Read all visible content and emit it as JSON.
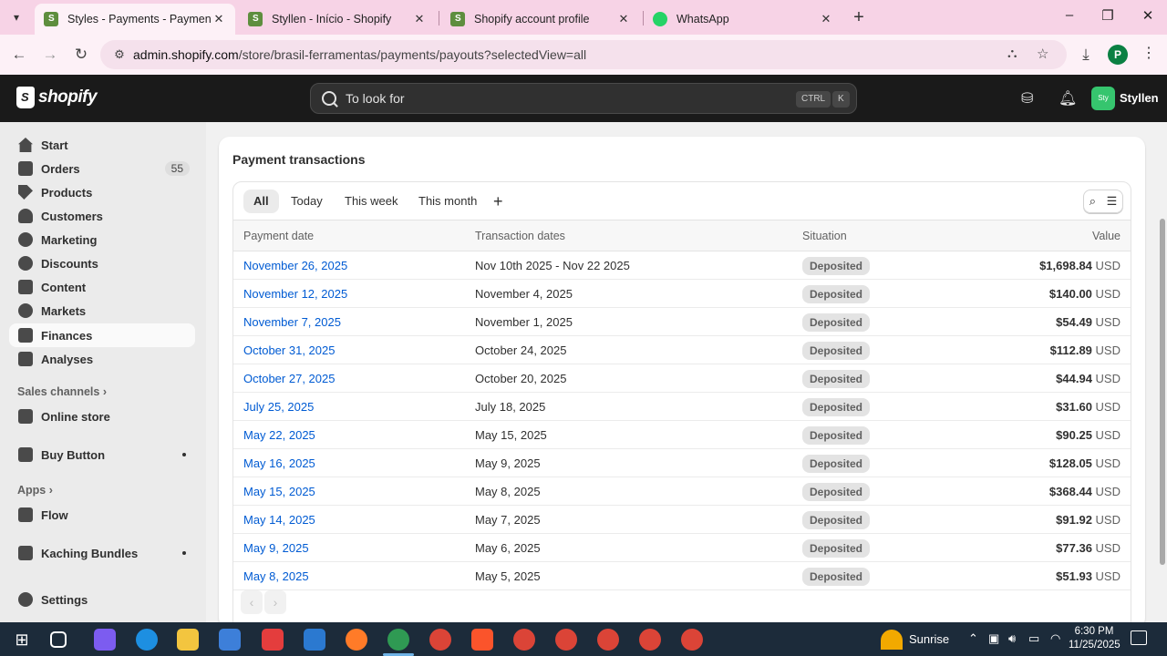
{
  "browser": {
    "tabs": [
      {
        "title": "Styles - Payments - Payment details",
        "icon": "shopify-favicon",
        "active": true
      },
      {
        "title": "Styllen - Início - Shopify",
        "icon": "shopify-favicon",
        "active": false
      },
      {
        "title": "Shopify account profile",
        "icon": "shopify-favicon",
        "active": false
      },
      {
        "title": "WhatsApp",
        "icon": "whatsapp-favicon",
        "active": false
      }
    ],
    "url_host": "admin.shopify.com",
    "url_path": "/store/brasil-ferramentas/payments/payouts?selectedView=all",
    "profile_initial": "P",
    "colors": {
      "tabbar": "#f7d3e6",
      "toolbar": "#fdf1f7"
    }
  },
  "header": {
    "logo_text": "shopify",
    "search_placeholder": "To look for",
    "shortcut_keys": [
      "CTRL",
      "K"
    ],
    "store_avatar": "Sty",
    "store_name": "Styllen",
    "colors": {
      "background": "#1a1a1a",
      "avatar": "#36c56e"
    }
  },
  "sidebar": {
    "items": [
      {
        "label": "Start",
        "icon": "home-icon"
      },
      {
        "label": "Orders",
        "icon": "orders-icon",
        "badge": "55"
      },
      {
        "label": "Products",
        "icon": "tag-icon"
      },
      {
        "label": "Customers",
        "icon": "person-icon"
      },
      {
        "label": "Marketing",
        "icon": "target-icon"
      },
      {
        "label": "Discounts",
        "icon": "discount-icon"
      },
      {
        "label": "Content",
        "icon": "content-icon"
      },
      {
        "label": "Markets",
        "icon": "globe-icon"
      },
      {
        "label": "Finances",
        "icon": "bank-icon",
        "active": true
      },
      {
        "label": "Analyses",
        "icon": "chart-icon"
      }
    ],
    "sales_channels_label": "Sales channels",
    "online_store": "Online store",
    "buy_button": "Buy Button",
    "apps_label": "Apps",
    "flow": "Flow",
    "kaching": "Kaching Bundles",
    "settings": "Settings"
  },
  "main": {
    "title": "Payment transactions",
    "filter_tabs": [
      "All",
      "Today",
      "This week",
      "This month"
    ],
    "active_filter": "All",
    "columns": {
      "payment_date": "Payment date",
      "transaction_dates": "Transaction dates",
      "situation": "Situation",
      "value": "Value"
    },
    "rows": [
      {
        "payment_date": "November 26, 2025",
        "transaction_dates": "Nov 10th 2025 - Nov 22 2025",
        "situation": "Deposited",
        "amount": "$1,698.84",
        "currency": "USD"
      },
      {
        "payment_date": "November 12, 2025",
        "transaction_dates": "November 4, 2025",
        "situation": "Deposited",
        "amount": "$140.00",
        "currency": "USD"
      },
      {
        "payment_date": "November 7, 2025",
        "transaction_dates": "November 1, 2025",
        "situation": "Deposited",
        "amount": "$54.49",
        "currency": "USD"
      },
      {
        "payment_date": "October 31, 2025",
        "transaction_dates": "October 24, 2025",
        "situation": "Deposited",
        "amount": "$112.89",
        "currency": "USD"
      },
      {
        "payment_date": "October 27, 2025",
        "transaction_dates": "October 20, 2025",
        "situation": "Deposited",
        "amount": "$44.94",
        "currency": "USD"
      },
      {
        "payment_date": "July 25, 2025",
        "transaction_dates": "July 18, 2025",
        "situation": "Deposited",
        "amount": "$31.60",
        "currency": "USD"
      },
      {
        "payment_date": "May 22, 2025",
        "transaction_dates": "May 15, 2025",
        "situation": "Deposited",
        "amount": "$90.25",
        "currency": "USD"
      },
      {
        "payment_date": "May 16, 2025",
        "transaction_dates": "May 9, 2025",
        "situation": "Deposited",
        "amount": "$128.05",
        "currency": "USD"
      },
      {
        "payment_date": "May 15, 2025",
        "transaction_dates": "May 8, 2025",
        "situation": "Deposited",
        "amount": "$368.44",
        "currency": "USD"
      },
      {
        "payment_date": "May 14, 2025",
        "transaction_dates": "May 7, 2025",
        "situation": "Deposited",
        "amount": "$91.92",
        "currency": "USD"
      },
      {
        "payment_date": "May 9, 2025",
        "transaction_dates": "May 6, 2025",
        "situation": "Deposited",
        "amount": "$77.36",
        "currency": "USD"
      },
      {
        "payment_date": "May 8, 2025",
        "transaction_dates": "May 5, 2025",
        "situation": "Deposited",
        "amount": "$51.93",
        "currency": "USD"
      }
    ],
    "colors": {
      "link": "#005bd3",
      "pill": "#e3e3e3"
    }
  },
  "taskbar": {
    "weather_label": "Sunrise",
    "time": "6:30 PM",
    "date": "11/25/2025",
    "background": "#1c2b3a"
  }
}
